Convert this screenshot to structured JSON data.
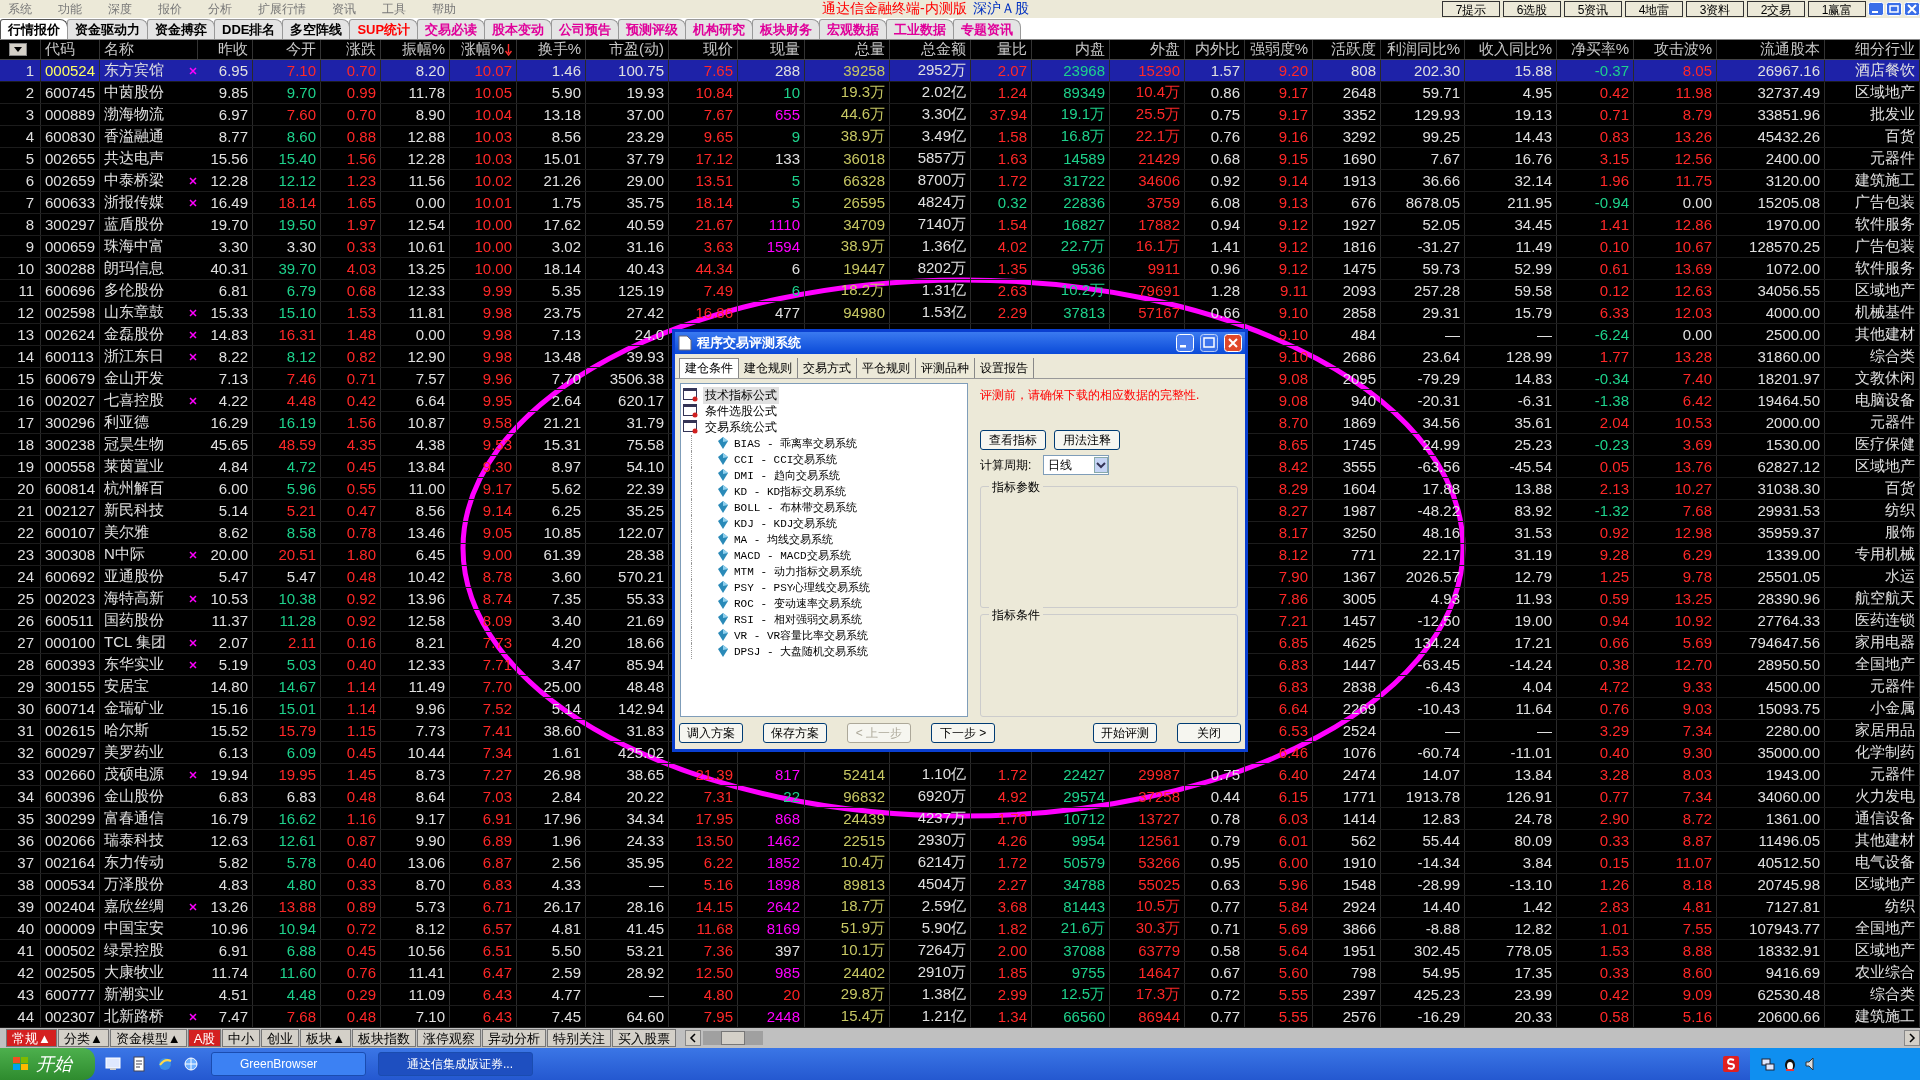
{
  "menu": [
    "系统",
    "功能",
    "深度",
    "报价",
    "分析",
    "扩展行情",
    "资讯",
    "工具",
    "帮助"
  ],
  "app_title": "通达信金融终端-内测版",
  "market": "深沪Ａ股",
  "hotkeys": [
    "7提示",
    "6选股",
    "5资讯",
    "4地雷",
    "3资料",
    "2交易",
    "1赢富"
  ],
  "tabs": [
    {
      "label": "行情报价",
      "selected": true,
      "color": "#000000"
    },
    {
      "label": "资金驱动力",
      "selected": false,
      "color": "#000000"
    },
    {
      "label": "资金搏弈",
      "selected": false,
      "color": "#000000"
    },
    {
      "label": "DDE排名",
      "selected": false,
      "color": "#000000"
    },
    {
      "label": "多空阵线",
      "selected": false,
      "color": "#000000"
    },
    {
      "label": "SUP统计",
      "selected": false,
      "color": "#ff0000"
    },
    {
      "label": "交易必读",
      "selected": false,
      "color": "#e0009a"
    },
    {
      "label": "股本变动",
      "selected": false,
      "color": "#e0009a"
    },
    {
      "label": "公司预告",
      "selected": false,
      "color": "#e0009a"
    },
    {
      "label": "预测评级",
      "selected": false,
      "color": "#e0009a"
    },
    {
      "label": "机构研究",
      "selected": false,
      "color": "#e0009a"
    },
    {
      "label": "板块财务",
      "selected": false,
      "color": "#e0009a"
    },
    {
      "label": "宏观数据",
      "selected": false,
      "color": "#e0009a"
    },
    {
      "label": "工业数据",
      "selected": false,
      "color": "#e0009a"
    },
    {
      "label": "专题资讯",
      "selected": false,
      "color": "#e0009a"
    }
  ],
  "columns": [
    {
      "label": "代码",
      "sorted": false
    },
    {
      "label": "名称",
      "sorted": false
    },
    {
      "label": "昨收",
      "sorted": false
    },
    {
      "label": "今开",
      "sorted": false
    },
    {
      "label": "涨跌",
      "sorted": false
    },
    {
      "label": "振幅%",
      "sorted": false
    },
    {
      "label": "涨幅%",
      "sorted": true
    },
    {
      "label": "换手%",
      "sorted": false
    },
    {
      "label": "市盈(动)",
      "sorted": false
    },
    {
      "label": "现价",
      "sorted": false
    },
    {
      "label": "现量",
      "sorted": false
    },
    {
      "label": "总量",
      "sorted": false
    },
    {
      "label": "总金额",
      "sorted": false
    },
    {
      "label": "量比",
      "sorted": false
    },
    {
      "label": "内盘",
      "sorted": false
    },
    {
      "label": "外盘",
      "sorted": false
    },
    {
      "label": "内外比",
      "sorted": false
    },
    {
      "label": "强弱度%",
      "sorted": false
    },
    {
      "label": "活跃度",
      "sorted": false
    },
    {
      "label": "利润同比%",
      "sorted": false
    },
    {
      "label": "收入同比%",
      "sorted": false
    },
    {
      "label": "净买率%",
      "sorted": false
    },
    {
      "label": "攻击波%",
      "sorted": false
    },
    {
      "label": "流通股本",
      "sorted": false
    },
    {
      "label": "细分行业",
      "sorted": false
    }
  ],
  "rows": [
    {
      "no": "1",
      "code": "000524",
      "name": "东方宾馆",
      "flagged": true,
      "selected": true,
      "color": "#e0e0e0",
      "cells": [
        "6.95",
        "7.10",
        "0.70",
        "8.20",
        "10.07",
        "1.46",
        "100.75",
        "7.65",
        "288",
        "39258",
        "2952万",
        "2.07",
        "23968",
        "15290",
        "1.57",
        "9.20",
        "808",
        "202.30",
        "15.88",
        "-0.37",
        "8.05",
        "26967.16",
        "酒店餐饮"
      ]
    },
    {
      "no": "2",
      "code": "600745",
      "name": "中茵股份",
      "flagged": false,
      "selected": false,
      "color": "#1ed28c",
      "cells": [
        "9.85",
        "9.70",
        "0.99",
        "11.78",
        "10.05",
        "5.90",
        "19.93",
        "10.84",
        "10",
        "19.3万",
        "2.02亿",
        "1.24",
        "89349",
        "10.4万",
        "0.86",
        "9.17",
        "2648",
        "59.71",
        "4.95",
        "0.42",
        "11.98",
        "32737.49",
        "区域地产"
      ]
    },
    {
      "no": "3",
      "code": "000889",
      "name": "渤海物流",
      "flagged": false,
      "selected": false,
      "color": "#ff00ff",
      "cells": [
        "6.97",
        "7.60",
        "0.70",
        "8.90",
        "10.04",
        "13.18",
        "37.00",
        "7.67",
        "655",
        "44.6万",
        "3.30亿",
        "37.94",
        "19.1万",
        "25.5万",
        "0.75",
        "9.17",
        "3352",
        "129.93",
        "19.13",
        "0.71",
        "8.79",
        "33851.96",
        "批发业"
      ]
    },
    {
      "no": "4",
      "code": "600830",
      "name": "香溢融通",
      "flagged": false,
      "selected": false,
      "color": "#1ed28c",
      "cells": [
        "8.77",
        "8.60",
        "0.88",
        "12.88",
        "10.03",
        "8.56",
        "23.29",
        "9.65",
        "9",
        "38.9万",
        "3.49亿",
        "1.58",
        "16.8万",
        "22.1万",
        "0.76",
        "9.16",
        "3292",
        "99.25",
        "14.43",
        "0.83",
        "13.26",
        "45432.26",
        "百货"
      ]
    },
    {
      "no": "5",
      "code": "002655",
      "name": "共达电声",
      "flagged": false,
      "selected": false,
      "color": "#e0e0e0",
      "cells": [
        "15.56",
        "15.40",
        "1.56",
        "12.28",
        "10.03",
        "15.01",
        "37.79",
        "17.12",
        "133",
        "36018",
        "5857万",
        "1.63",
        "14589",
        "21429",
        "0.68",
        "9.15",
        "1690",
        "7.67",
        "16.76",
        "3.15",
        "12.56",
        "2400.00",
        "元器件"
      ]
    },
    {
      "no": "6",
      "code": "002659",
      "name": "中泰桥梁",
      "flagged": true,
      "selected": false,
      "color": "#1ed28c",
      "cells": [
        "12.28",
        "12.12",
        "1.23",
        "11.56",
        "10.02",
        "21.26",
        "29.00",
        "13.51",
        "5",
        "66328",
        "8700万",
        "1.72",
        "31722",
        "34606",
        "0.92",
        "9.14",
        "1913",
        "36.66",
        "32.14",
        "1.96",
        "11.75",
        "3120.00",
        "建筑施工"
      ]
    },
    {
      "no": "7",
      "code": "600633",
      "name": "浙报传媒",
      "flagged": true,
      "selected": false,
      "color": "#1ed28c",
      "cells": [
        "16.49",
        "18.14",
        "1.65",
        "0.00",
        "10.01",
        "1.75",
        "35.75",
        "18.14",
        "5",
        "26595",
        "4824万",
        "0.32",
        "22836",
        "3759",
        "6.08",
        "9.13",
        "676",
        "8678.05",
        "211.95",
        "-0.94",
        "0.00",
        "15205.08",
        "广告包装"
      ]
    },
    {
      "no": "8",
      "code": "300297",
      "name": "蓝盾股份",
      "flagged": false,
      "selected": false,
      "color": "#ff00ff",
      "cells": [
        "19.70",
        "19.50",
        "1.97",
        "12.54",
        "10.00",
        "17.62",
        "40.59",
        "21.67",
        "1110",
        "34709",
        "7140万",
        "1.54",
        "16827",
        "17882",
        "0.94",
        "9.12",
        "1927",
        "52.05",
        "34.45",
        "1.41",
        "12.86",
        "1970.00",
        "软件服务"
      ]
    },
    {
      "no": "9",
      "code": "000659",
      "name": "珠海中富",
      "flagged": false,
      "selected": false,
      "color": "#ff00ff",
      "cells": [
        "3.30",
        "3.30",
        "0.33",
        "10.61",
        "10.00",
        "3.02",
        "31.16",
        "3.63",
        "1594",
        "38.9万",
        "1.36亿",
        "4.02",
        "22.7万",
        "16.1万",
        "1.41",
        "9.12",
        "1816",
        "-31.27",
        "11.49",
        "0.10",
        "10.67",
        "128570.25",
        "广告包装"
      ]
    },
    {
      "no": "10",
      "code": "300288",
      "name": "朗玛信息",
      "flagged": false,
      "selected": false,
      "color": "#e0e0e0",
      "cells": [
        "40.31",
        "39.70",
        "4.03",
        "13.25",
        "10.00",
        "18.14",
        "40.43",
        "44.34",
        "6",
        "19447",
        "8202万",
        "1.35",
        "9536",
        "9911",
        "0.96",
        "9.12",
        "1475",
        "59.73",
        "52.99",
        "0.61",
        "13.69",
        "1072.00",
        "软件服务"
      ]
    },
    {
      "no": "11",
      "code": "600696",
      "name": "多伦股份",
      "flagged": false,
      "selected": false,
      "color": "#1ed28c",
      "cells": [
        "6.81",
        "6.79",
        "0.68",
        "12.33",
        "9.99",
        "5.35",
        "125.19",
        "7.49",
        "6",
        "18.2万",
        "1.31亿",
        "2.63",
        "10.2万",
        "79691",
        "1.28",
        "9.11",
        "2093",
        "257.28",
        "59.58",
        "0.12",
        "12.63",
        "34056.55",
        "区域地产"
      ]
    },
    {
      "no": "12",
      "code": "002598",
      "name": "山东章鼓",
      "flagged": true,
      "selected": false,
      "color": "#e0e0e0",
      "cells": [
        "15.33",
        "15.10",
        "1.53",
        "11.81",
        "9.98",
        "23.75",
        "27.42",
        "16.86",
        "477",
        "94980",
        "1.53亿",
        "2.29",
        "37813",
        "57167",
        "0.66",
        "9.10",
        "2858",
        "29.31",
        "15.79",
        "6.33",
        "12.03",
        "4000.00",
        "机械基件"
      ]
    },
    {
      "no": "13",
      "code": "002624",
      "name": "金磊股份",
      "flagged": true,
      "selected": false,
      "cells": [
        "14.83",
        "16.31",
        "1.48",
        "0.00",
        "9.98",
        "7.13",
        "24.0",
        null,
        null,
        null,
        null,
        null,
        null,
        null,
        null,
        "9.10",
        "484",
        "—",
        "—",
        "-6.24",
        "0.00",
        "2500.00",
        "其他建材"
      ]
    },
    {
      "no": "14",
      "code": "600113",
      "name": "浙江东日",
      "flagged": true,
      "selected": false,
      "cells": [
        "8.22",
        "8.12",
        "0.82",
        "12.90",
        "9.98",
        "13.48",
        "39.93",
        null,
        null,
        null,
        null,
        null,
        null,
        null,
        null,
        "9.10",
        "2686",
        "23.64",
        "128.99",
        "1.77",
        "13.28",
        "31860.00",
        "综合类"
      ]
    },
    {
      "no": "15",
      "code": "600679",
      "name": "金山开发",
      "flagged": false,
      "selected": false,
      "cells": [
        "7.13",
        "7.46",
        "0.71",
        "7.57",
        "9.96",
        "7.70",
        "3506.38",
        null,
        null,
        null,
        null,
        null,
        null,
        null,
        null,
        "9.08",
        "2095",
        "-79.29",
        "14.83",
        "-0.34",
        "7.40",
        "18201.97",
        "文教休闲"
      ]
    },
    {
      "no": "16",
      "code": "002027",
      "name": "七喜控股",
      "flagged": true,
      "selected": false,
      "cells": [
        "4.22",
        "4.48",
        "0.42",
        "6.64",
        "9.95",
        "2.64",
        "620.17",
        null,
        null,
        null,
        null,
        null,
        null,
        null,
        null,
        "9.08",
        "940",
        "-20.31",
        "-6.31",
        "-1.38",
        "6.42",
        "19464.50",
        "电脑设备"
      ]
    },
    {
      "no": "17",
      "code": "300296",
      "name": "利亚德",
      "flagged": false,
      "selected": false,
      "cells": [
        "16.29",
        "16.19",
        "1.56",
        "10.87",
        "9.58",
        "21.21",
        "31.79",
        null,
        null,
        null,
        null,
        null,
        null,
        null,
        null,
        "8.70",
        "1869",
        "34.56",
        "35.61",
        "2.04",
        "10.53",
        "2000.00",
        "元器件"
      ]
    },
    {
      "no": "18",
      "code": "300238",
      "name": "冠昊生物",
      "flagged": false,
      "selected": false,
      "cells": [
        "45.65",
        "48.59",
        "4.35",
        "4.38",
        "9.53",
        "15.31",
        "75.58",
        null,
        null,
        null,
        null,
        null,
        null,
        null,
        null,
        "8.65",
        "1745",
        "24.99",
        "25.23",
        "-0.23",
        "3.69",
        "1530.00",
        "医疗保健"
      ]
    },
    {
      "no": "19",
      "code": "000558",
      "name": "莱茵置业",
      "flagged": false,
      "selected": false,
      "cells": [
        "4.84",
        "4.72",
        "0.45",
        "13.84",
        "9.30",
        "8.97",
        "54.10",
        null,
        null,
        null,
        null,
        null,
        null,
        null,
        null,
        "8.42",
        "3555",
        "-63.56",
        "-45.54",
        "0.05",
        "13.76",
        "62827.12",
        "区域地产"
      ]
    },
    {
      "no": "20",
      "code": "600814",
      "name": "杭州解百",
      "flagged": false,
      "selected": false,
      "cells": [
        "6.00",
        "5.96",
        "0.55",
        "11.00",
        "9.17",
        "5.62",
        "22.39",
        null,
        null,
        null,
        null,
        null,
        null,
        null,
        null,
        "8.29",
        "1604",
        "17.88",
        "13.88",
        "2.13",
        "10.27",
        "31038.30",
        "百货"
      ]
    },
    {
      "no": "21",
      "code": "002127",
      "name": "新民科技",
      "flagged": false,
      "selected": false,
      "cells": [
        "5.14",
        "5.21",
        "0.47",
        "8.56",
        "9.14",
        "6.25",
        "35.25",
        null,
        null,
        null,
        null,
        null,
        null,
        null,
        null,
        "8.27",
        "1987",
        "-48.22",
        "83.92",
        "-1.32",
        "7.68",
        "29931.53",
        "纺织"
      ]
    },
    {
      "no": "22",
      "code": "600107",
      "name": "美尔雅",
      "flagged": false,
      "selected": false,
      "cells": [
        "8.62",
        "8.58",
        "0.78",
        "13.46",
        "9.05",
        "10.85",
        "122.07",
        null,
        null,
        null,
        null,
        null,
        null,
        null,
        null,
        "8.17",
        "3250",
        "48.16",
        "31.53",
        "0.92",
        "12.98",
        "35959.37",
        "服饰"
      ]
    },
    {
      "no": "23",
      "code": "300308",
      "name": "N中际",
      "flagged": true,
      "selected": false,
      "cells": [
        "20.00",
        "20.51",
        "1.80",
        "6.45",
        "9.00",
        "61.39",
        "28.38",
        null,
        null,
        null,
        null,
        null,
        null,
        null,
        null,
        "8.12",
        "771",
        "22.17",
        "31.19",
        "9.28",
        "6.29",
        "1339.00",
        "专用机械"
      ]
    },
    {
      "no": "24",
      "code": "600692",
      "name": "亚通股份",
      "flagged": false,
      "selected": false,
      "cells": [
        "5.47",
        "5.47",
        "0.48",
        "10.42",
        "8.78",
        "3.60",
        "570.21",
        null,
        null,
        null,
        null,
        null,
        null,
        null,
        null,
        "7.90",
        "1367",
        "2026.57",
        "12.79",
        "1.25",
        "9.78",
        "25501.05",
        "水运"
      ]
    },
    {
      "no": "25",
      "code": "002023",
      "name": "海特高新",
      "flagged": true,
      "selected": false,
      "cells": [
        "10.53",
        "10.38",
        "0.92",
        "13.96",
        "8.74",
        "7.35",
        "55.33",
        null,
        null,
        null,
        null,
        null,
        null,
        null,
        null,
        "7.86",
        "3005",
        "4.93",
        "11.93",
        "0.59",
        "13.25",
        "28390.96",
        "航空航天"
      ]
    },
    {
      "no": "26",
      "code": "600511",
      "name": "国药股份",
      "flagged": false,
      "selected": false,
      "cells": [
        "11.37",
        "11.28",
        "0.92",
        "12.58",
        "8.09",
        "3.40",
        "21.69",
        null,
        null,
        null,
        null,
        null,
        null,
        null,
        null,
        "7.21",
        "1457",
        "-12.50",
        "19.00",
        "0.94",
        "10.92",
        "27764.33",
        "医药连锁"
      ]
    },
    {
      "no": "27",
      "code": "000100",
      "name": "TCL 集团",
      "flagged": true,
      "selected": false,
      "cells": [
        "2.07",
        "2.11",
        "0.16",
        "8.21",
        "7.73",
        "4.20",
        "18.66",
        null,
        null,
        null,
        null,
        null,
        null,
        null,
        null,
        "6.85",
        "4625",
        "134.24",
        "17.21",
        "0.66",
        "5.69",
        "794647.56",
        "家用电器"
      ]
    },
    {
      "no": "28",
      "code": "600393",
      "name": "东华实业",
      "flagged": true,
      "selected": false,
      "cells": [
        "5.19",
        "5.03",
        "0.40",
        "12.33",
        "7.71",
        "3.47",
        "85.94",
        null,
        null,
        null,
        null,
        null,
        null,
        null,
        null,
        "6.83",
        "1447",
        "-63.45",
        "-14.24",
        "0.38",
        "12.70",
        "28950.50",
        "全国地产"
      ]
    },
    {
      "no": "29",
      "code": "300155",
      "name": "安居宝",
      "flagged": false,
      "selected": false,
      "cells": [
        "14.80",
        "14.67",
        "1.14",
        "11.49",
        "7.70",
        "25.00",
        "48.48",
        null,
        null,
        null,
        null,
        null,
        null,
        null,
        null,
        "6.83",
        "2838",
        "-6.43",
        "4.04",
        "4.72",
        "9.33",
        "4500.00",
        "元器件"
      ]
    },
    {
      "no": "30",
      "code": "600714",
      "name": "金瑞矿业",
      "flagged": false,
      "selected": false,
      "cells": [
        "15.16",
        "15.01",
        "1.14",
        "9.96",
        "7.52",
        "5.14",
        "142.94",
        null,
        null,
        null,
        null,
        null,
        null,
        null,
        null,
        "6.64",
        "2269",
        "-10.43",
        "11.64",
        "0.76",
        "9.03",
        "15093.75",
        "小金属"
      ]
    },
    {
      "no": "31",
      "code": "002615",
      "name": "哈尔斯",
      "flagged": false,
      "selected": false,
      "cells": [
        "15.52",
        "15.79",
        "1.15",
        "7.73",
        "7.41",
        "38.60",
        "31.83",
        null,
        null,
        null,
        null,
        null,
        null,
        null,
        null,
        "6.53",
        "2524",
        "—",
        "—",
        "3.29",
        "7.34",
        "2280.00",
        "家居用品"
      ]
    },
    {
      "no": "32",
      "code": "600297",
      "name": "美罗药业",
      "flagged": false,
      "selected": false,
      "cells": [
        "6.13",
        "6.09",
        "0.45",
        "10.44",
        "7.34",
        "1.61",
        "425.02",
        null,
        null,
        null,
        null,
        null,
        null,
        null,
        null,
        "6.46",
        "1076",
        "-60.74",
        "-11.01",
        "0.40",
        "9.30",
        "35000.00",
        "化学制药"
      ]
    },
    {
      "no": "33",
      "code": "002660",
      "name": "茂硕电源",
      "flagged": true,
      "selected": false,
      "color": "#ff00ff",
      "cells": [
        "19.94",
        "19.95",
        "1.45",
        "8.73",
        "7.27",
        "26.98",
        "38.65",
        "21.39",
        "817",
        "52414",
        "1.10亿",
        "1.72",
        "22427",
        "29987",
        "0.75",
        "6.40",
        "2474",
        "14.07",
        "13.84",
        "3.28",
        "8.03",
        "1943.00",
        "元器件"
      ]
    },
    {
      "no": "34",
      "code": "600396",
      "name": "金山股份",
      "flagged": false,
      "selected": false,
      "color": "#1ed28c",
      "cells": [
        "6.83",
        "6.83",
        "0.48",
        "8.64",
        "7.03",
        "2.84",
        "20.22",
        "7.31",
        "22",
        "96832",
        "6920万",
        "4.92",
        "29574",
        "37258",
        "0.44",
        "6.15",
        "1771",
        "1913.78",
        "126.91",
        "0.77",
        "7.34",
        "34060.00",
        "火力发电"
      ]
    },
    {
      "no": "35",
      "code": "300299",
      "name": "富春通信",
      "flagged": false,
      "selected": false,
      "color": "#ff00ff",
      "cells": [
        "16.79",
        "16.62",
        "1.16",
        "9.17",
        "6.91",
        "17.96",
        "34.34",
        "17.95",
        "868",
        "24439",
        "4237万",
        "1.70",
        "10712",
        "13727",
        "0.78",
        "6.03",
        "1414",
        "12.83",
        "24.78",
        "2.90",
        "8.72",
        "1361.00",
        "通信设备"
      ]
    },
    {
      "no": "36",
      "code": "002066",
      "name": "瑞泰科技",
      "flagged": false,
      "selected": false,
      "color": "#ff00ff",
      "cells": [
        "12.63",
        "12.61",
        "0.87",
        "9.90",
        "6.89",
        "1.96",
        "24.33",
        "13.50",
        "1462",
        "22515",
        "2930万",
        "4.26",
        "9954",
        "12561",
        "0.79",
        "6.01",
        "562",
        "55.44",
        "80.09",
        "0.33",
        "8.87",
        "11496.05",
        "其他建材"
      ]
    },
    {
      "no": "37",
      "code": "002164",
      "name": "东力传动",
      "flagged": false,
      "selected": false,
      "color": "#ff00ff",
      "cells": [
        "5.82",
        "5.78",
        "0.40",
        "13.06",
        "6.87",
        "2.56",
        "35.95",
        "6.22",
        "1852",
        "10.4万",
        "6214万",
        "1.72",
        "50579",
        "53266",
        "0.95",
        "6.00",
        "1910",
        "-14.34",
        "3.84",
        "0.15",
        "11.07",
        "40512.50",
        "电气设备"
      ]
    },
    {
      "no": "38",
      "code": "000534",
      "name": "万泽股份",
      "flagged": false,
      "selected": false,
      "color": "#ff00ff",
      "cells": [
        "4.83",
        "4.80",
        "0.33",
        "8.70",
        "6.83",
        "4.33",
        "—",
        "5.16",
        "1898",
        "89813",
        "4504万",
        "2.27",
        "34788",
        "55025",
        "0.63",
        "5.96",
        "1548",
        "-28.99",
        "-13.10",
        "1.26",
        "8.18",
        "20745.98",
        "区域地产"
      ]
    },
    {
      "no": "39",
      "code": "002404",
      "name": "嘉欣丝绸",
      "flagged": true,
      "selected": false,
      "color": "#ff00ff",
      "cells": [
        "13.26",
        "13.88",
        "0.89",
        "5.73",
        "6.71",
        "26.17",
        "28.16",
        "14.15",
        "2642",
        "18.7万",
        "2.59亿",
        "3.68",
        "81443",
        "10.5万",
        "0.77",
        "5.84",
        "2924",
        "14.40",
        "1.42",
        "2.83",
        "4.81",
        "7127.81",
        "纺织"
      ]
    },
    {
      "no": "40",
      "code": "000009",
      "name": "中国宝安",
      "flagged": false,
      "selected": false,
      "color": "#ff00ff",
      "cells": [
        "10.96",
        "10.94",
        "0.72",
        "8.12",
        "6.57",
        "4.81",
        "41.45",
        "11.68",
        "8169",
        "51.9万",
        "5.90亿",
        "1.82",
        "21.6万",
        "30.3万",
        "0.71",
        "5.69",
        "3866",
        "-8.88",
        "12.82",
        "1.01",
        "7.55",
        "107943.77",
        "全国地产"
      ]
    },
    {
      "no": "41",
      "code": "000502",
      "name": "绿景控股",
      "flagged": false,
      "selected": false,
      "color": "#e0e0e0",
      "cells": [
        "6.91",
        "6.88",
        "0.45",
        "10.56",
        "6.51",
        "5.50",
        "53.21",
        "7.36",
        "397",
        "10.1万",
        "7264万",
        "2.00",
        "37088",
        "63779",
        "0.58",
        "5.64",
        "1951",
        "302.45",
        "778.05",
        "1.53",
        "8.88",
        "18332.91",
        "区域地产"
      ]
    },
    {
      "no": "42",
      "code": "002505",
      "name": "大康牧业",
      "flagged": false,
      "selected": false,
      "color": "#ff00ff",
      "cells": [
        "11.74",
        "11.60",
        "0.76",
        "11.41",
        "6.47",
        "2.59",
        "28.92",
        "12.50",
        "985",
        "24402",
        "2910万",
        "1.85",
        "9755",
        "14647",
        "0.67",
        "5.60",
        "798",
        "54.95",
        "17.35",
        "0.33",
        "8.60",
        "9416.69",
        "农业综合"
      ]
    },
    {
      "no": "43",
      "code": "600777",
      "name": "新潮实业",
      "flagged": false,
      "selected": false,
      "color": "#ff2020",
      "cells": [
        "4.51",
        "4.48",
        "0.29",
        "11.09",
        "6.43",
        "4.77",
        "—",
        "4.80",
        "20",
        "29.8万",
        "1.38亿",
        "2.99",
        "12.5万",
        "17.3万",
        "0.72",
        "5.55",
        "2397",
        "425.23",
        "23.99",
        "0.42",
        "9.09",
        "62530.48",
        "综合类"
      ]
    },
    {
      "no": "44",
      "code": "002307",
      "name": "北新路桥",
      "flagged": true,
      "selected": false,
      "color": "#ff00ff",
      "cells": [
        "7.47",
        "7.68",
        "0.48",
        "7.10",
        "6.43",
        "7.45",
        "64.60",
        "7.95",
        "2448",
        "15.4万",
        "1.21亿",
        "1.34",
        "66560",
        "86944",
        "0.77",
        "5.55",
        "2576",
        "-16.29",
        "20.33",
        "0.58",
        "5.16",
        "20600.66",
        "建筑施工"
      ]
    }
  ],
  "bottom_tabs": [
    {
      "label": "常规▲",
      "selected": true
    },
    {
      "label": "分类▲",
      "selected": false
    },
    {
      "label": "资金模型▲",
      "selected": false
    },
    {
      "label": "A股",
      "selected": true
    },
    {
      "label": "中小",
      "selected": false
    },
    {
      "label": "创业",
      "selected": false
    },
    {
      "label": "板块▲",
      "selected": false
    },
    {
      "label": "板块指数",
      "selected": false
    },
    {
      "label": "涨停观察",
      "selected": false
    },
    {
      "label": "异动分析",
      "selected": false
    },
    {
      "label": "特别关注",
      "selected": false
    },
    {
      "label": "买入股票",
      "selected": false
    }
  ],
  "taskbar": {
    "start": "开始",
    "tasks": [
      {
        "label": "GreenBrowser",
        "selected": false
      },
      {
        "label": "通达信集成版证券...",
        "selected": true
      }
    ]
  },
  "dialog": {
    "title": "程序交易评测系统",
    "tabs": [
      {
        "label": "建仓条件",
        "selected": true
      },
      {
        "label": "建仓规则",
        "selected": false
      },
      {
        "label": "交易方式",
        "selected": false
      },
      {
        "label": "平仓规则",
        "selected": false
      },
      {
        "label": "评测品种",
        "selected": false
      },
      {
        "label": "设置报告",
        "selected": false
      }
    ],
    "tree": [
      {
        "label": "技术指标公式",
        "selected": true
      },
      {
        "label": "条件选股公式",
        "selected": false
      },
      {
        "label": "交易系统公式",
        "selected": false,
        "children": [
          {
            "label": "BIAS - 乖离率交易系统"
          },
          {
            "label": "CCI - CCI交易系统"
          },
          {
            "label": "DMI - 趋向交易系统"
          },
          {
            "label": "KD - KD指标交易系统"
          },
          {
            "label": "BOLL - 布林带交易系统"
          },
          {
            "label": "KDJ - KDJ交易系统"
          },
          {
            "label": "MA - 均线交易系统"
          },
          {
            "label": "MACD - MACD交易系统"
          },
          {
            "label": "MTM - 动力指标交易系统"
          },
          {
            "label": "PSY - PSY心理线交易系统"
          },
          {
            "label": "ROC - 变动速率交易系统"
          },
          {
            "label": "RSI - 相对强弱交易系统"
          },
          {
            "label": "VR - VR容量比率交易系统"
          },
          {
            "label": "DPSJ - 大盘随机交易系统"
          }
        ]
      }
    ],
    "warning": "评测前，请确保下载的相应数据的完整性.",
    "side_buttons": [
      "查看指标",
      "用法注释"
    ],
    "period": {
      "label": "计算周期:",
      "value": "日线"
    },
    "groups": [
      "指标参数",
      "指标条件"
    ],
    "buttons": [
      {
        "label": "调入方案",
        "disabled": false
      },
      {
        "label": "保存方案",
        "disabled": false
      },
      {
        "label": "< 上一步",
        "disabled": true
      },
      {
        "label": "下一步 >",
        "disabled": false
      },
      {
        "label": "开始评测",
        "disabled": false
      },
      {
        "label": "关闭",
        "disabled": false
      }
    ]
  }
}
